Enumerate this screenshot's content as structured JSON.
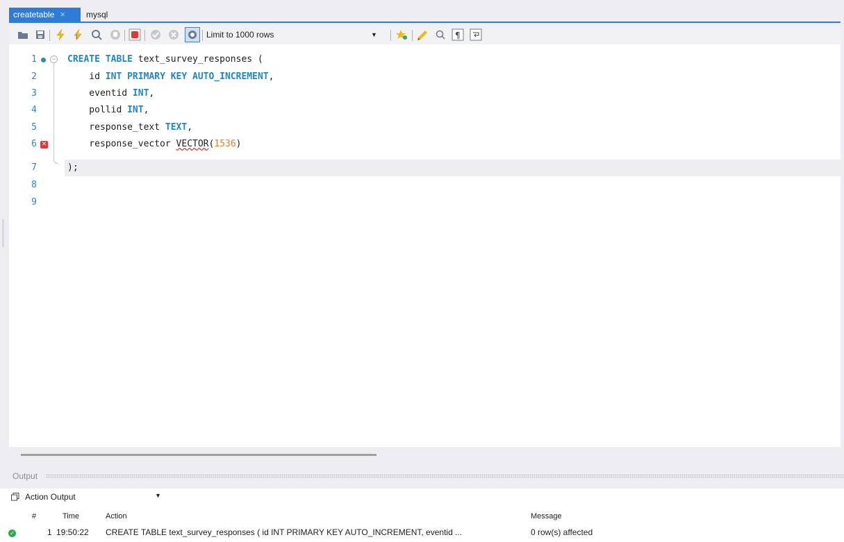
{
  "tabs": [
    {
      "label": "createtable",
      "active": true,
      "close": "×"
    },
    {
      "label": "mysql",
      "active": false
    }
  ],
  "toolbar": {
    "icons": [
      "open-folder-icon",
      "save-icon",
      "execute-icon",
      "execute-current-icon",
      "explain-icon",
      "stop-icon",
      "toggle-error-icon",
      "commit-icon",
      "rollback-icon",
      "autocommit-icon",
      "limit-dropdown",
      "bookmark-icon",
      "beautify-icon",
      "find-icon",
      "invisible-chars-icon",
      "wrap-icon"
    ],
    "limit_label": "Limit to 1000 rows",
    "accent": "#2e7cd8"
  },
  "editor": {
    "line_numbers": [
      "1",
      "2",
      "3",
      "4",
      "5",
      "6",
      "7",
      "8",
      "9"
    ],
    "lines": [
      {
        "parts": [
          [
            "kw",
            "CREATE TABLE"
          ],
          [
            "",
            "text_survey_responses ("
          ]
        ]
      },
      {
        "parts": [
          [
            "",
            "    id "
          ],
          [
            "kw",
            "INT PRIMARY KEY AUTO_INCREMENT"
          ],
          [
            "",
            ","
          ]
        ]
      },
      {
        "parts": [
          [
            "",
            "    eventid "
          ],
          [
            "kw",
            "INT"
          ],
          [
            "",
            ","
          ]
        ]
      },
      {
        "parts": [
          [
            "",
            "    pollid "
          ],
          [
            "kw",
            "INT"
          ],
          [
            "",
            ","
          ]
        ]
      },
      {
        "parts": [
          [
            "",
            "    response_text "
          ],
          [
            "kw",
            "TEXT"
          ],
          [
            "",
            ","
          ]
        ]
      },
      {
        "parts": [
          [
            "",
            "    response_vector "
          ],
          [
            "err",
            "VECTOR"
          ],
          [
            "",
            "("
          ],
          [
            "num",
            "1536"
          ],
          [
            "",
            ")"
          ]
        ]
      },
      {
        "parts": [
          [
            "",
            ");"
          ]
        ]
      },
      {
        "parts": []
      },
      {
        "parts": []
      }
    ]
  },
  "output": {
    "header": "Output",
    "selector": "Action Output",
    "columns": [
      "#",
      "Time",
      "Action",
      "Message"
    ],
    "rows": [
      {
        "num": "1",
        "time": "19:50:22",
        "action": "CREATE TABLE text_survey_responses (    id INT PRIMARY KEY AUTO_INCREMENT,    eventid ...",
        "message": "0 row(s) affected",
        "status": "success"
      }
    ]
  }
}
